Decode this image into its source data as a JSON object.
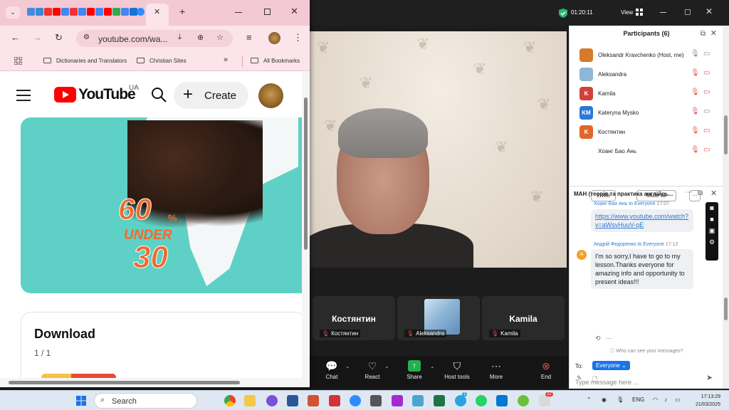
{
  "zoom": {
    "timer": "01:20:11",
    "view_label": "View",
    "participants_title": "Participants (6)",
    "participants": [
      {
        "name": "Oleksandr Kravchenko (Host, me)",
        "avatar_text": "",
        "avatar_color": "#d87a2a",
        "mic": "on",
        "cam": "on"
      },
      {
        "name": "Aleksandra",
        "avatar_text": "",
        "avatar_color": "#8fb6d7",
        "mic": "muted",
        "cam": "off"
      },
      {
        "name": "Kamila",
        "avatar_text": "K",
        "avatar_color": "#d0413b",
        "mic": "muted",
        "cam": "off"
      },
      {
        "name": "Kateryna Mysko",
        "avatar_text": "KM",
        "avatar_color": "#2a7ad6",
        "mic": "muted",
        "cam": "on"
      },
      {
        "name": "Костянтин",
        "avatar_text": "K",
        "avatar_color": "#e0672a",
        "mic": "muted",
        "cam": "off"
      },
      {
        "name": "Хоанг Бао Ань",
        "avatar_text": "",
        "avatar_color": "#ffffff",
        "mic": "muted",
        "cam": "off"
      }
    ],
    "invite_label": "Invite",
    "mute_all_label": "Mute all",
    "more_label": "···",
    "chat_title": "МАН (теорія та практика англійсь...",
    "messages": [
      {
        "meta": "Хоанг Бао Ань to Everyone",
        "time": "17:07",
        "text": "https://www.youtube.com/watch?v=aWsvHuuV-qE",
        "link": true
      },
      {
        "meta": "Андрій Федоренко to Everyone",
        "time": "17:12",
        "avatar": "A",
        "text": "I'm so sorry,I have to go to my lesson.Thanks everyone for amazing info and opportunity to present ideas!!!",
        "link": false
      }
    ],
    "who_can_see": "Who can see your messages?",
    "to_label": "To:",
    "to_value": "Everyone",
    "type_placeholder": "Type message here ...",
    "tiles": [
      {
        "name": "Костянтин",
        "label": "Костянтин"
      },
      {
        "name": "",
        "label": "Aleksandra"
      },
      {
        "name": "Kamila",
        "label": "Kamila"
      }
    ],
    "toolbar": {
      "chat": "Chat",
      "react": "React",
      "share": "Share",
      "host_tools": "Host tools",
      "more": "More",
      "end": "End"
    },
    "accent": "#2a7ad6"
  },
  "chrome": {
    "url": "youtube.com/wa...",
    "bookmarks": [
      "Dictionaries and Translators",
      "Christian Sites"
    ],
    "all_bookmarks": "All Bookmarks",
    "tab_bar_color": "#f3c9d4"
  },
  "youtube": {
    "brand": "YouTube",
    "region": "UA",
    "create_label": "Create",
    "banner_pct": "60",
    "banner_pct_sign": "%",
    "banner_under": "UNDER",
    "banner_thirty": "30",
    "download_title": "Download",
    "download_count": "1 / 1"
  },
  "taskbar": {
    "search_label": "Search",
    "lang": "ENG",
    "time": "17:13:29",
    "date": "21/03/2025",
    "badge_telegram": "1",
    "badge_store": "22"
  }
}
